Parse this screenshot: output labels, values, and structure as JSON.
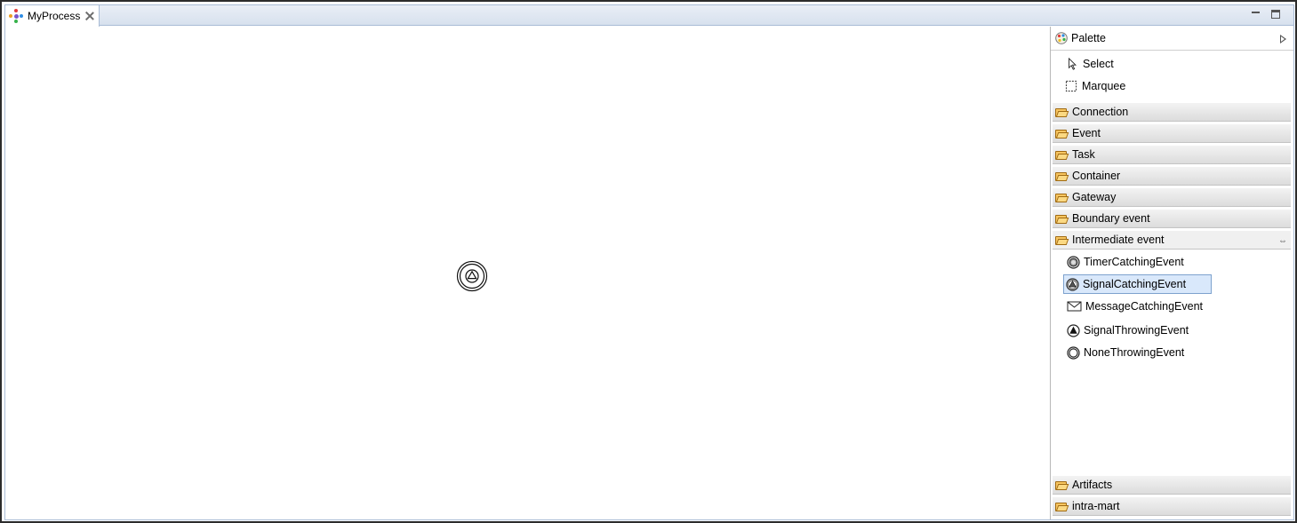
{
  "editor": {
    "tab_label": "MyProcess"
  },
  "palette": {
    "title": "Palette",
    "tools": [
      {
        "label": "Select",
        "icon": "arrow-pointer-icon"
      },
      {
        "label": "Marquee",
        "icon": "marquee-icon"
      }
    ],
    "drawers": [
      {
        "label": "Connection"
      },
      {
        "label": "Event"
      },
      {
        "label": "Task"
      },
      {
        "label": "Container"
      },
      {
        "label": "Gateway"
      },
      {
        "label": "Boundary event"
      },
      {
        "label": "Intermediate event"
      }
    ],
    "intermediate_entries": [
      {
        "label": "TimerCatchingEvent",
        "icon": "timer-event-icon"
      },
      {
        "label": "SignalCatchingEvent",
        "icon": "signal-catching-icon",
        "selected": true
      },
      {
        "label": "MessageCatchingEvent",
        "icon": "envelope-icon"
      },
      {
        "label": "SignalThrowingEvent",
        "icon": "signal-throwing-icon"
      },
      {
        "label": "NoneThrowingEvent",
        "icon": "none-throwing-icon"
      }
    ],
    "bottom_drawers": [
      {
        "label": "Artifacts"
      },
      {
        "label": "intra-mart"
      }
    ]
  },
  "colors": {
    "selection": "#d9e8fb",
    "folder": "#f7c560"
  }
}
